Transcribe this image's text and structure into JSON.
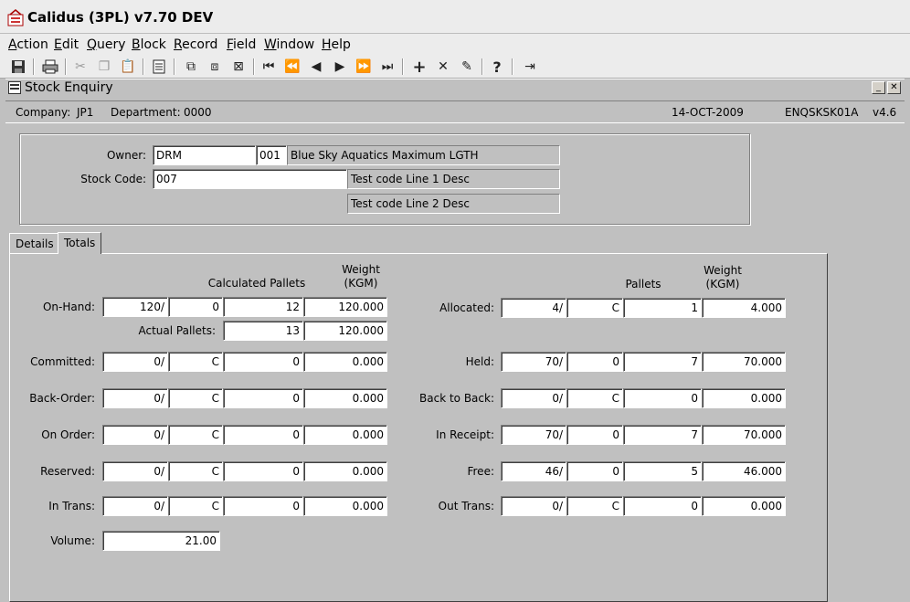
{
  "window": {
    "title": "Calidus (3PL) v7.70 DEV"
  },
  "menu": [
    {
      "label": "Action",
      "u": "A"
    },
    {
      "label": "Edit",
      "u": "E"
    },
    {
      "label": "Query",
      "u": "Q"
    },
    {
      "label": "Block",
      "u": "B"
    },
    {
      "label": "Record",
      "u": "R"
    },
    {
      "label": "Field",
      "u": "F"
    },
    {
      "label": "Window",
      "u": "W"
    },
    {
      "label": "Help",
      "u": "H"
    }
  ],
  "toolbar": {
    "icons": [
      "save-icon",
      "print-icon",
      "cut-icon",
      "copy-icon",
      "paste-icon",
      "list-icon",
      "query-enter-icon",
      "query-execute-icon",
      "query-cancel-icon",
      "first-block-icon",
      "previous-set-icon",
      "previous-record-icon",
      "next-record-icon",
      "next-set-icon",
      "last-block-icon",
      "insert-record-icon",
      "delete-record-icon",
      "clear-icon",
      "help-icon",
      "exit-icon"
    ]
  },
  "form": {
    "title": "Stock Enquiry",
    "company_label": "Company:",
    "company": "JP1",
    "department_label": "Department:",
    "department": "0000",
    "date": "14-OCT-2009",
    "form_code": "ENQSKSK01A",
    "version": "v4.6"
  },
  "header": {
    "owner_label": "Owner:",
    "owner_code": "DRM",
    "owner_num": "001",
    "owner_desc": "Blue Sky Aquatics Maximum LGTH",
    "stock_label": "Stock Code:",
    "stock_code": "007",
    "desc1": "Test code Line 1 Desc",
    "desc2": "Test code Line 2 Desc"
  },
  "tabs": [
    {
      "label": "Details",
      "active": false
    },
    {
      "label": "Totals",
      "active": true
    }
  ],
  "totals": {
    "left_headers": {
      "calc_pallets": "Calculated Pallets",
      "weight": "Weight",
      "weight_unit": "(KGM)"
    },
    "right_headers": {
      "pallets": "Pallets",
      "weight": "Weight",
      "weight_unit": "(KGM)"
    },
    "actual_pallets_label": "Actual Pallets:",
    "actual_pallets": "13",
    "actual_weight": "120.000",
    "left_rows": [
      {
        "label": "On-Hand:",
        "qty": "120/",
        "sub": "0",
        "pallets": "12",
        "weight": "120.000"
      },
      {
        "label": "Committed:",
        "qty": "0/",
        "sub": "C",
        "pallets": "0",
        "weight": "0.000"
      },
      {
        "label": "Back-Order:",
        "qty": "0/",
        "sub": "C",
        "pallets": "0",
        "weight": "0.000"
      },
      {
        "label": "On Order:",
        "qty": "0/",
        "sub": "C",
        "pallets": "0",
        "weight": "0.000"
      },
      {
        "label": "Reserved:",
        "qty": "0/",
        "sub": "C",
        "pallets": "0",
        "weight": "0.000"
      },
      {
        "label": "In Trans:",
        "qty": "0/",
        "sub": "C",
        "pallets": "0",
        "weight": "0.000"
      }
    ],
    "right_rows": [
      {
        "label": "Allocated:",
        "qty": "4/",
        "sub": "C",
        "pallets": "1",
        "weight": "4.000"
      },
      {
        "label": "Held:",
        "qty": "70/",
        "sub": "0",
        "pallets": "7",
        "weight": "70.000"
      },
      {
        "label": "Back to Back:",
        "qty": "0/",
        "sub": "C",
        "pallets": "0",
        "weight": "0.000"
      },
      {
        "label": "In Receipt:",
        "qty": "70/",
        "sub": "0",
        "pallets": "7",
        "weight": "70.000"
      },
      {
        "label": "Free:",
        "qty": "46/",
        "sub": "0",
        "pallets": "5",
        "weight": "46.000"
      },
      {
        "label": "Out Trans:",
        "qty": "0/",
        "sub": "C",
        "pallets": "0",
        "weight": "0.000"
      }
    ],
    "volume_label": "Volume:",
    "volume": "21.00"
  }
}
